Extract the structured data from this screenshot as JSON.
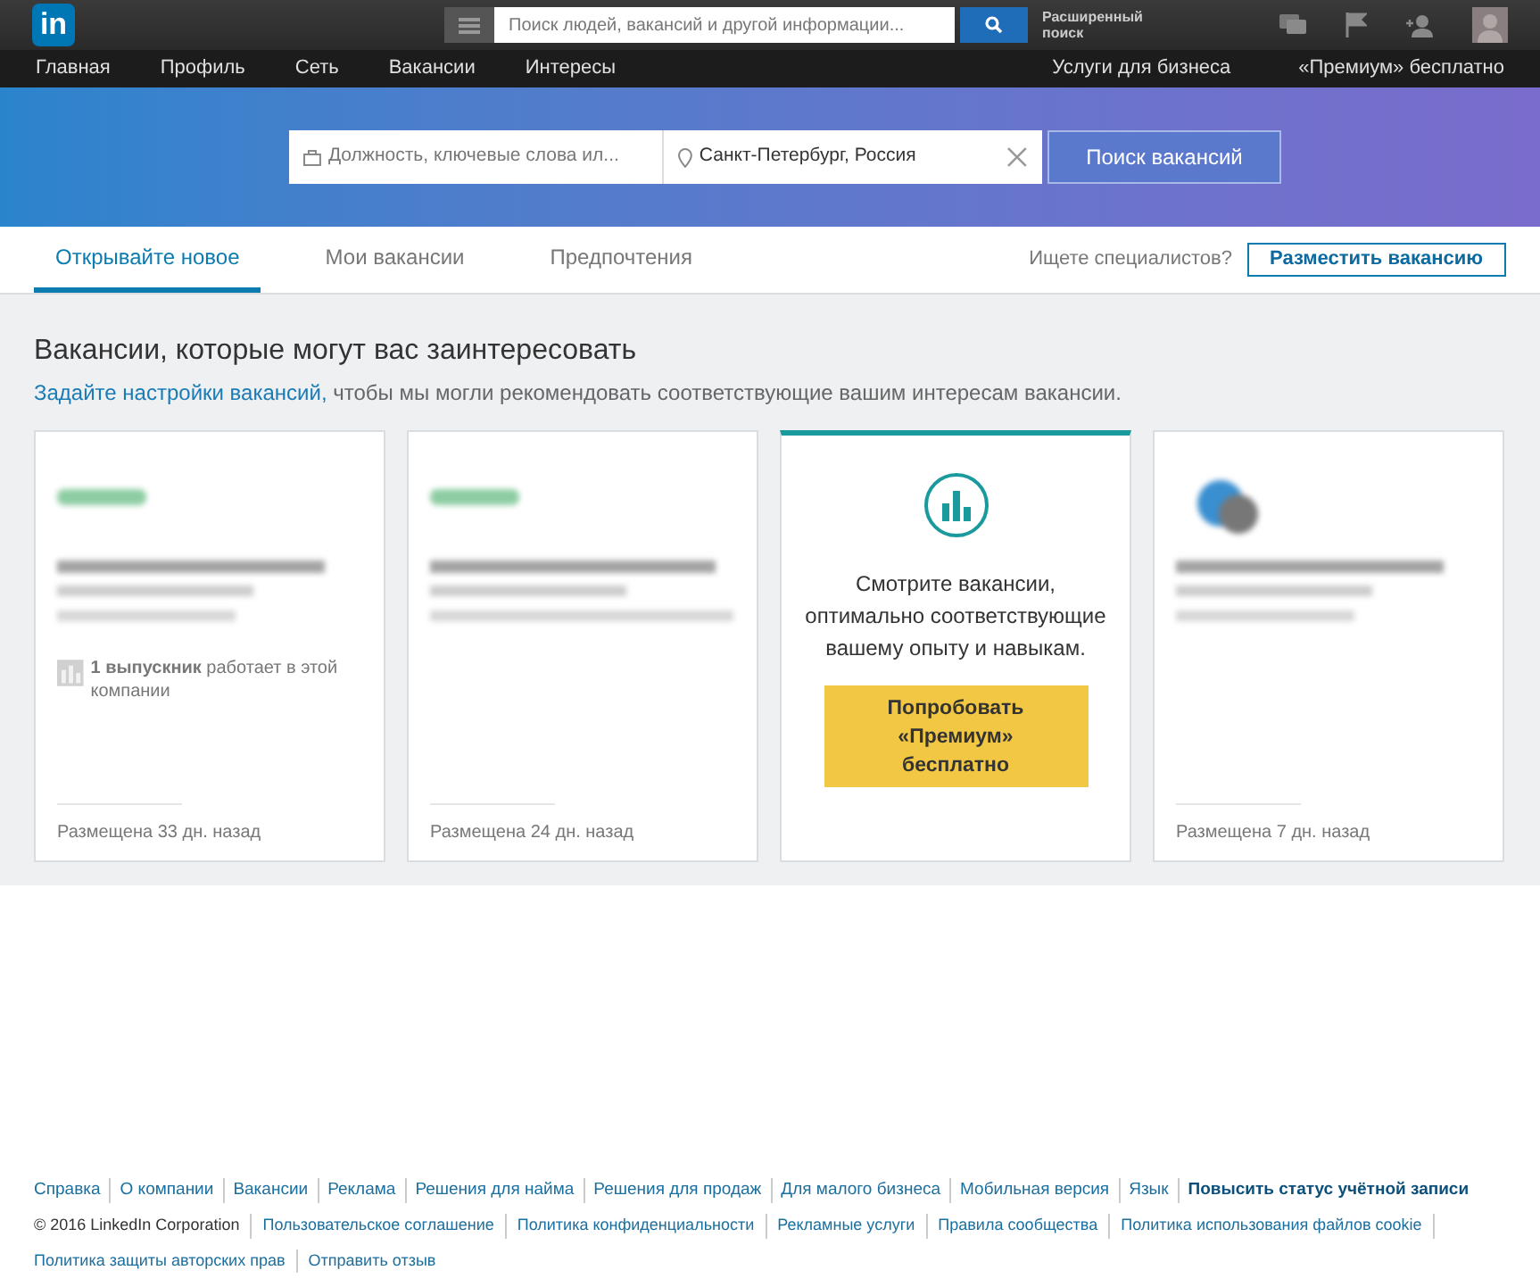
{
  "header": {
    "logo": "in",
    "search": {
      "placeholder": "Поиск людей, вакансий и другой информации..."
    },
    "advanced_search": "Расширенный поиск"
  },
  "nav": {
    "items": [
      "Главная",
      "Профиль",
      "Сеть",
      "Вакансии",
      "Интересы"
    ],
    "right_items": [
      "Услуги для бизнеса",
      "«Премиум» бесплатно"
    ]
  },
  "job_search": {
    "keywords": {
      "placeholder": "Должность, ключевые слова ил..."
    },
    "location": {
      "value": "Санкт-Петербург, Россия"
    },
    "button": "Поиск вакансий"
  },
  "tabs": [
    {
      "label": "Открывайте новое",
      "selected": true
    },
    {
      "label": "Мои вакансии",
      "selected": false
    },
    {
      "label": "Предпочтения",
      "selected": false
    }
  ],
  "recruiter": {
    "prompt": "Ищете специалистов?",
    "button": "Разместить вакансию"
  },
  "section": {
    "title": "Вакансии, которые могут вас заинтересовать",
    "link": "Задайте настройки вакансий,",
    "text": " чтобы мы могли рекомендовать соответствующие вашим интересам вакансии."
  },
  "cards": [
    {
      "kind": "job",
      "alumni": "**1 выпускник** работает в этой компании",
      "posted": "Размещена 33 дн. назад"
    },
    {
      "kind": "job",
      "posted": "Размещена 24 дн. назад"
    },
    {
      "kind": "promo",
      "text": "Смотрите вакансии, оптимально соответствующие вашему опыту и навыкам.",
      "button": "Попробовать «Премиум» бесплатно"
    },
    {
      "kind": "job",
      "posted": "Размещена 7 дн. назад"
    }
  ],
  "footer": {
    "links": [
      "Справка",
      "О компании",
      "Вакансии",
      "Реклама",
      "Решения для найма",
      "Решения для продаж",
      "Для малого бизнеса",
      "Мобильная версия",
      "Язык",
      "Повысить статус учётной записи"
    ],
    "copyright": "© 2016 LinkedIn Corporation",
    "legal": [
      "Пользовательское соглашение",
      "Политика конфиденциальности",
      "Рекламные услуги",
      "Правила сообщества",
      "Политика использования файлов cookie",
      "Политика защиты авторских прав",
      "Отправить отзыв"
    ]
  }
}
